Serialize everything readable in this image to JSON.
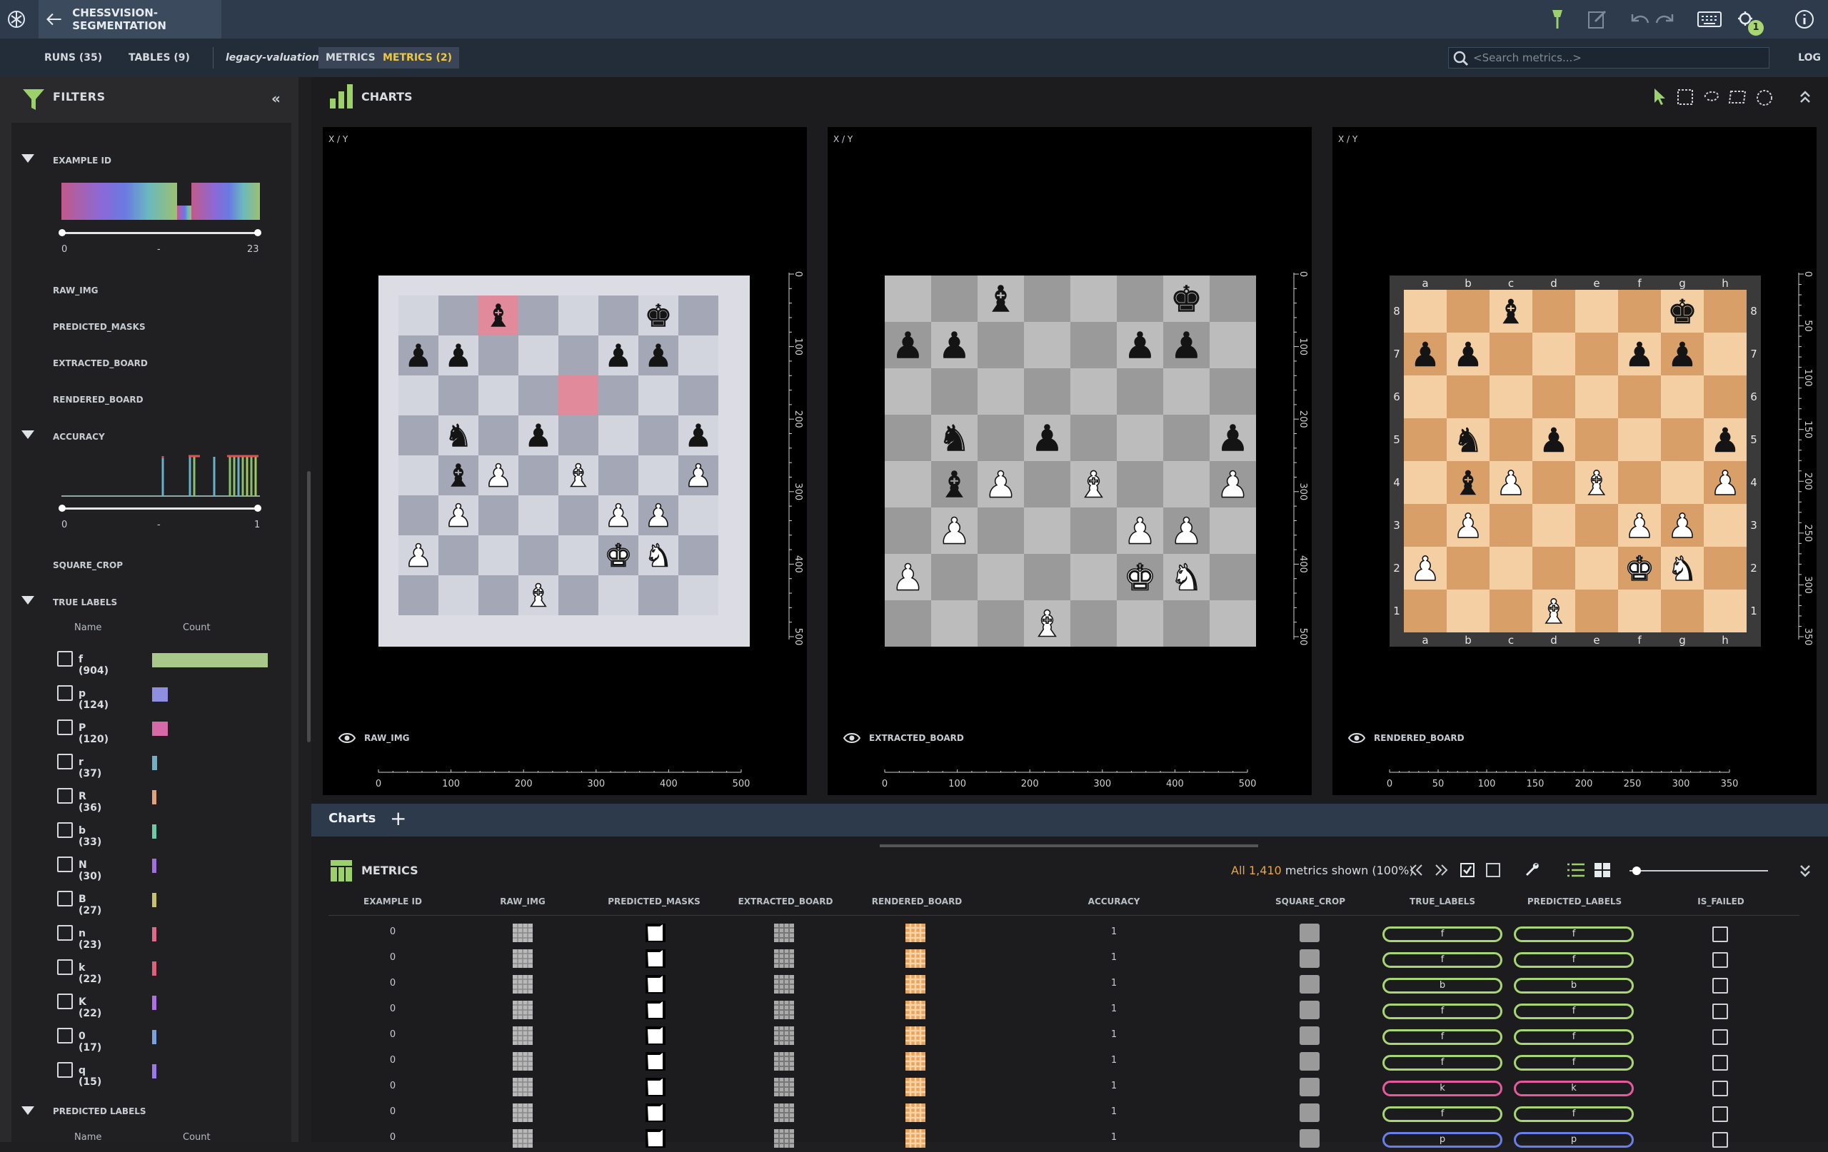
{
  "project": {
    "name": "CHESSVISION-SEGMENTATION"
  },
  "toolbar": {
    "notification_count": "1"
  },
  "tabs": {
    "runs": "RUNS (35)",
    "tables": "TABLES (9)",
    "context": "legacy-valuation:",
    "metrics": "METRICS",
    "metrics2": "METRICS (2)",
    "log": "LOG"
  },
  "search": {
    "placeholder": "<Search metrics...>"
  },
  "filters": {
    "title": "FILTERS",
    "example_id": {
      "label": "EXAMPLE ID",
      "min": "0",
      "dash": "-",
      "max": "23"
    },
    "items": [
      "RAW_IMG",
      "PREDICTED_MASKS",
      "EXTRACTED_BOARD",
      "RENDERED_BOARD"
    ],
    "accuracy": {
      "label": "ACCURACY",
      "min": "0",
      "dash": "-",
      "max": "1"
    },
    "square_crop": "SQUARE_CROP",
    "true_labels": {
      "label": "TRUE LABELS",
      "col_name": "Name",
      "col_count": "Count",
      "rows": [
        {
          "name": "f (904)",
          "count": 904,
          "color": "#a8c98a"
        },
        {
          "name": "p (124)",
          "count": 124,
          "color": "#8f8fe0"
        },
        {
          "name": "P (120)",
          "count": 120,
          "color": "#d56aa6"
        },
        {
          "name": "r (37)",
          "count": 37,
          "color": "#6fb0c8"
        },
        {
          "name": "R (36)",
          "count": 36,
          "color": "#e0a27a"
        },
        {
          "name": "b (33)",
          "count": 33,
          "color": "#6ec9a4"
        },
        {
          "name": "N (30)",
          "count": 30,
          "color": "#a070e0"
        },
        {
          "name": "B (27)",
          "count": 27,
          "color": "#c9c26a"
        },
        {
          "name": "n (23)",
          "count": 23,
          "color": "#e06a8a"
        },
        {
          "name": "k (22)",
          "count": 22,
          "color": "#e0607a"
        },
        {
          "name": "K (22)",
          "count": 22,
          "color": "#b070e8"
        },
        {
          "name": "0 (17)",
          "count": 17,
          "color": "#7aa0e0"
        },
        {
          "name": "q (15)",
          "count": 15,
          "color": "#9a7ae8"
        }
      ]
    },
    "predicted_labels": {
      "label": "PREDICTED LABELS",
      "col_name": "Name",
      "col_count": "Count"
    }
  },
  "charts": {
    "title": "CHARTS",
    "panels": [
      {
        "axis_label": "X / Y",
        "name": "RAW_IMG"
      },
      {
        "axis_label": "X / Y",
        "name": "EXTRACTED_BOARD"
      },
      {
        "axis_label": "X / Y",
        "name": "RENDERED_BOARD"
      }
    ],
    "board_x_ticks": [
      "0",
      "100",
      "200",
      "300",
      "400",
      "500"
    ],
    "board_y_ticks": [
      "0",
      "100",
      "200",
      "300",
      "400",
      "500"
    ],
    "rendered_x_ticks": [
      "0",
      "50",
      "100",
      "150",
      "200",
      "250",
      "300",
      "350"
    ],
    "rendered_y_ticks": [
      "0",
      "50",
      "100",
      "150",
      "200",
      "250",
      "300",
      "350"
    ],
    "files": [
      "a",
      "b",
      "c",
      "d",
      "e",
      "f",
      "g",
      "h"
    ],
    "ranks": [
      "8",
      "7",
      "6",
      "5",
      "4",
      "3",
      "2",
      "1"
    ],
    "position": [
      "..b...k.",
      "pp...pp.",
      "........",
      ".n.p...p",
      ".bP.B..P",
      ".P...PP.",
      "P....KN.",
      "...B...."
    ]
  },
  "bottom_tabs": {
    "charts": "Charts",
    "add": "+"
  },
  "metrics": {
    "title": "METRICS",
    "shown_all": "All 1,410",
    "shown_rest": " metrics shown (100%)",
    "columns": [
      "EXAMPLE ID",
      "RAW_IMG",
      "PREDICTED_MASKS",
      "EXTRACTED_BOARD",
      "RENDERED_BOARD",
      "ACCURACY",
      "SQUARE_CROP",
      "TRUE_LABELS",
      "PREDICTED_LABELS",
      "IS_FAILED"
    ],
    "rows": [
      {
        "id": "0",
        "acc": "1",
        "true": "f",
        "pred": "f",
        "color": "green"
      },
      {
        "id": "0",
        "acc": "1",
        "true": "f",
        "pred": "f",
        "color": "green"
      },
      {
        "id": "0",
        "acc": "1",
        "true": "b",
        "pred": "b",
        "color": "green"
      },
      {
        "id": "0",
        "acc": "1",
        "true": "f",
        "pred": "f",
        "color": "green"
      },
      {
        "id": "0",
        "acc": "1",
        "true": "f",
        "pred": "f",
        "color": "green"
      },
      {
        "id": "0",
        "acc": "1",
        "true": "f",
        "pred": "f",
        "color": "green"
      },
      {
        "id": "0",
        "acc": "1",
        "true": "k",
        "pred": "k",
        "color": "pink"
      },
      {
        "id": "0",
        "acc": "1",
        "true": "f",
        "pred": "f",
        "color": "green"
      },
      {
        "id": "0",
        "acc": "1",
        "true": "p",
        "pred": "p",
        "color": "blue"
      }
    ]
  }
}
